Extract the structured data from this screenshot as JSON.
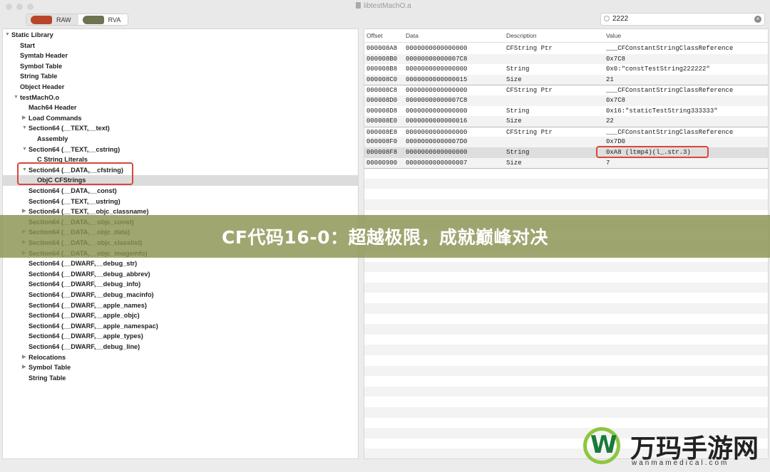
{
  "window": {
    "title": "libtestMachO.a"
  },
  "toolbar": {
    "raw_label": "RAW",
    "rva_label": "RVA",
    "colors": {
      "raw_thumb": "#b8452a",
      "rva_thumb": "#6f7350"
    }
  },
  "search": {
    "value": "2222",
    "icon": "search-icon",
    "clear_icon": "clear-icon"
  },
  "tree": [
    {
      "label": "Static Library",
      "level": 0,
      "disclosure": "open"
    },
    {
      "label": "Start",
      "level": 1,
      "disclosure": "none"
    },
    {
      "label": "Symtab Header",
      "level": 1,
      "disclosure": "none"
    },
    {
      "label": "Symbol Table",
      "level": 1,
      "disclosure": "none"
    },
    {
      "label": "String Table",
      "level": 1,
      "disclosure": "none"
    },
    {
      "label": "Object Header",
      "level": 1,
      "disclosure": "none"
    },
    {
      "label": "testMachO.o",
      "level": 1,
      "disclosure": "open"
    },
    {
      "label": "Mach64 Header",
      "level": 2,
      "disclosure": "none"
    },
    {
      "label": "Load Commands",
      "level": 2,
      "disclosure": "closed"
    },
    {
      "label": "Section64 (__TEXT,__text)",
      "level": 2,
      "disclosure": "open"
    },
    {
      "label": "Assembly",
      "level": 3,
      "disclosure": "none"
    },
    {
      "label": "Section64 (__TEXT,__cstring)",
      "level": 2,
      "disclosure": "open"
    },
    {
      "label": "C String Literals",
      "level": 3,
      "disclosure": "none"
    },
    {
      "label": "Section64 (__DATA,__cfstring)",
      "level": 2,
      "disclosure": "open"
    },
    {
      "label": "ObjC CFStrings",
      "level": 3,
      "disclosure": "none",
      "selected": true
    },
    {
      "label": "Section64 (__DATA,__const)",
      "level": 2,
      "disclosure": "none"
    },
    {
      "label": "Section64 (__TEXT,__ustring)",
      "level": 2,
      "disclosure": "none"
    },
    {
      "label": "Section64 (__TEXT,__objc_classname)",
      "level": 2,
      "disclosure": "closed"
    },
    {
      "label": "Section64 (__DATA,__objc_const)",
      "level": 2,
      "disclosure": "none"
    },
    {
      "label": "Section64 (__DATA,__objc_data)",
      "level": 2,
      "disclosure": "closed"
    },
    {
      "label": "Section64 (__DATA,__objc_classlist)",
      "level": 2,
      "disclosure": "closed"
    },
    {
      "label": "Section64 (__DATA,__objc_imageinfo)",
      "level": 2,
      "disclosure": "closed"
    },
    {
      "label": "Section64 (__DWARF,__debug_str)",
      "level": 2,
      "disclosure": "none"
    },
    {
      "label": "Section64 (__DWARF,__debug_abbrev)",
      "level": 2,
      "disclosure": "none"
    },
    {
      "label": "Section64 (__DWARF,__debug_info)",
      "level": 2,
      "disclosure": "none"
    },
    {
      "label": "Section64 (__DWARF,__debug_macinfo)",
      "level": 2,
      "disclosure": "none"
    },
    {
      "label": "Section64 (__DWARF,__apple_names)",
      "level": 2,
      "disclosure": "none"
    },
    {
      "label": "Section64 (__DWARF,__apple_objc)",
      "level": 2,
      "disclosure": "none"
    },
    {
      "label": "Section64 (__DWARF,__apple_namespac)",
      "level": 2,
      "disclosure": "none"
    },
    {
      "label": "Section64 (__DWARF,__apple_types)",
      "level": 2,
      "disclosure": "none"
    },
    {
      "label": "Section64 (__DWARF,__debug_line)",
      "level": 2,
      "disclosure": "none"
    },
    {
      "label": "Relocations",
      "level": 2,
      "disclosure": "closed"
    },
    {
      "label": "Symbol Table",
      "level": 2,
      "disclosure": "closed"
    },
    {
      "label": "String Table",
      "level": 2,
      "disclosure": "none"
    }
  ],
  "table": {
    "columns": [
      "Offset",
      "Data",
      "Description",
      "Value"
    ],
    "rows": [
      [
        "000008A8",
        "0000000000000000",
        "CFString Ptr",
        "___CFConstantStringClassReference"
      ],
      [
        "000008B0",
        "00000000000007C8",
        "",
        "0x7C8"
      ],
      [
        "000008B8",
        "0000000000000000",
        "String",
        "0x0:\"constTestString222222\""
      ],
      [
        "000008C0",
        "0000000000000015",
        "Size",
        "21"
      ],
      [
        "000008C8",
        "0000000000000000",
        "CFString Ptr",
        "___CFConstantStringClassReference"
      ],
      [
        "000008D0",
        "00000000000007C8",
        "",
        "0x7C8"
      ],
      [
        "000008D8",
        "0000000000000000",
        "String",
        "0x16:\"staticTestString333333\""
      ],
      [
        "000008E0",
        "0000000000000016",
        "Size",
        "22"
      ],
      [
        "000008E8",
        "0000000000000000",
        "CFString Ptr",
        "___CFConstantStringClassReference"
      ],
      [
        "000008F0",
        "00000000000007D0",
        "",
        "0x7D0"
      ],
      [
        "000008F8",
        "0000000000000000",
        "String",
        "0xA8 (ltmp4)(l_.str.3)"
      ],
      [
        "00000900",
        "0000000000000007",
        "Size",
        "7"
      ]
    ],
    "highlighted_row": 10
  },
  "banner": {
    "headline": "CF代码16-0：超越极限，成就巅峰对决"
  },
  "watermark": {
    "logo_text": "万玛手游网",
    "logo_subtext": "wanmamedical.com"
  },
  "colors": {
    "highlight_box": "#d9463a",
    "banner": "#8b9250",
    "selection": "#dcdcdc"
  }
}
